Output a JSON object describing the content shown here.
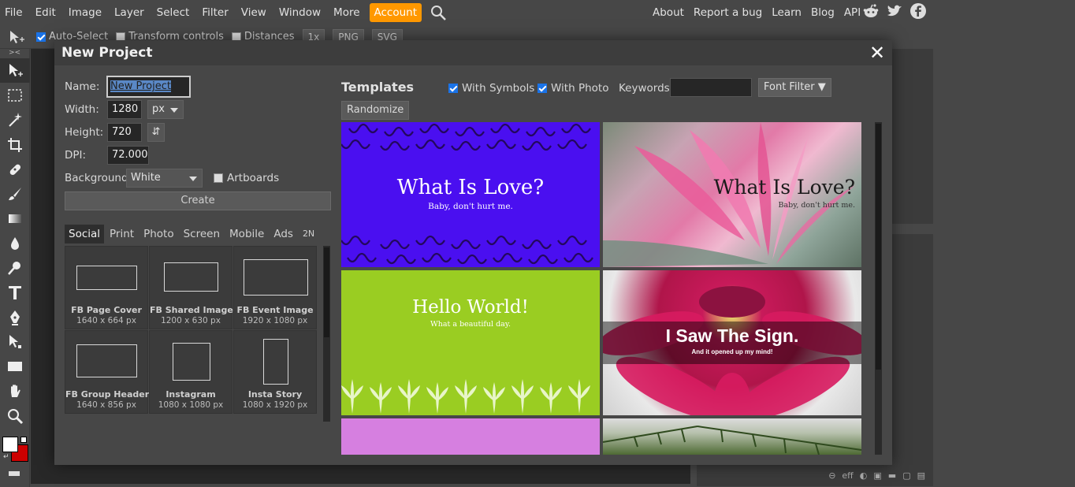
{
  "menubar": {
    "items": [
      "File",
      "Edit",
      "Image",
      "Layer",
      "Select",
      "Filter",
      "View",
      "Window",
      "More"
    ],
    "account": "Account",
    "right_links": [
      "About",
      "Report a bug",
      "Learn",
      "Blog",
      "API"
    ],
    "social_icons": [
      "reddit-icon",
      "twitter-icon",
      "facebook-icon"
    ]
  },
  "options_bar": {
    "auto_select": "Auto-Select",
    "transform_controls": "Transform controls",
    "distances": "Distances",
    "zoom": "1x",
    "png": "PNG",
    "svg": "SVG"
  },
  "dialog": {
    "title": "New Project",
    "close": "✕",
    "name_label": "Name:",
    "name_value": "New Project",
    "width_label": "Width:",
    "width_value": "1280",
    "unit": "px",
    "height_label": "Height:",
    "height_value": "720",
    "dpi_label": "DPI:",
    "dpi_value": "72.000",
    "background_label": "Background:",
    "background_value": "White",
    "artboards_label": "Artboards",
    "create_label": "Create",
    "tabs": [
      "Social",
      "Print",
      "Photo",
      "Screen",
      "Mobile",
      "Ads",
      "2N"
    ],
    "presets": [
      {
        "name": "FB Page Cover",
        "size": "1640 x 664 px"
      },
      {
        "name": "FB Shared Image",
        "size": "1200 x 630 px"
      },
      {
        "name": "FB Event Image",
        "size": "1920 x 1080 px"
      },
      {
        "name": "FB Group Header",
        "size": "1640 x 856 px"
      },
      {
        "name": "Instagram",
        "size": "1080 x 1080 px"
      },
      {
        "name": "Insta Story",
        "size": "1080 x 1920 px"
      }
    ],
    "templates_title": "Templates",
    "with_symbols": "With Symbols",
    "with_photo": "With Photo",
    "keywords_label": "Keywords:",
    "keywords_value": "",
    "font_filter": "Font Filter ▼",
    "randomize": "Randomize",
    "templates": [
      {
        "title": "What Is Love?",
        "subtitle": "Baby, don't hurt me.",
        "bg": "#4a0ff0"
      },
      {
        "title": "What Is Love?",
        "subtitle": "Baby, don't hurt me.",
        "bg": "#b86a8e"
      },
      {
        "title": "Hello World!",
        "subtitle": "What a beautiful day.",
        "bg": "#9acd22"
      },
      {
        "title": "I Saw The Sign.",
        "subtitle": "And it opened up my mind!",
        "bg": "#c0143c"
      },
      {
        "title": "",
        "subtitle": "",
        "bg": "#d67fe0"
      },
      {
        "title": "",
        "subtitle": "",
        "bg": "#6b7a55"
      }
    ]
  },
  "colors": {
    "foreground": "#ffffff",
    "background": "#cc0000",
    "accent": "#ff9800"
  }
}
